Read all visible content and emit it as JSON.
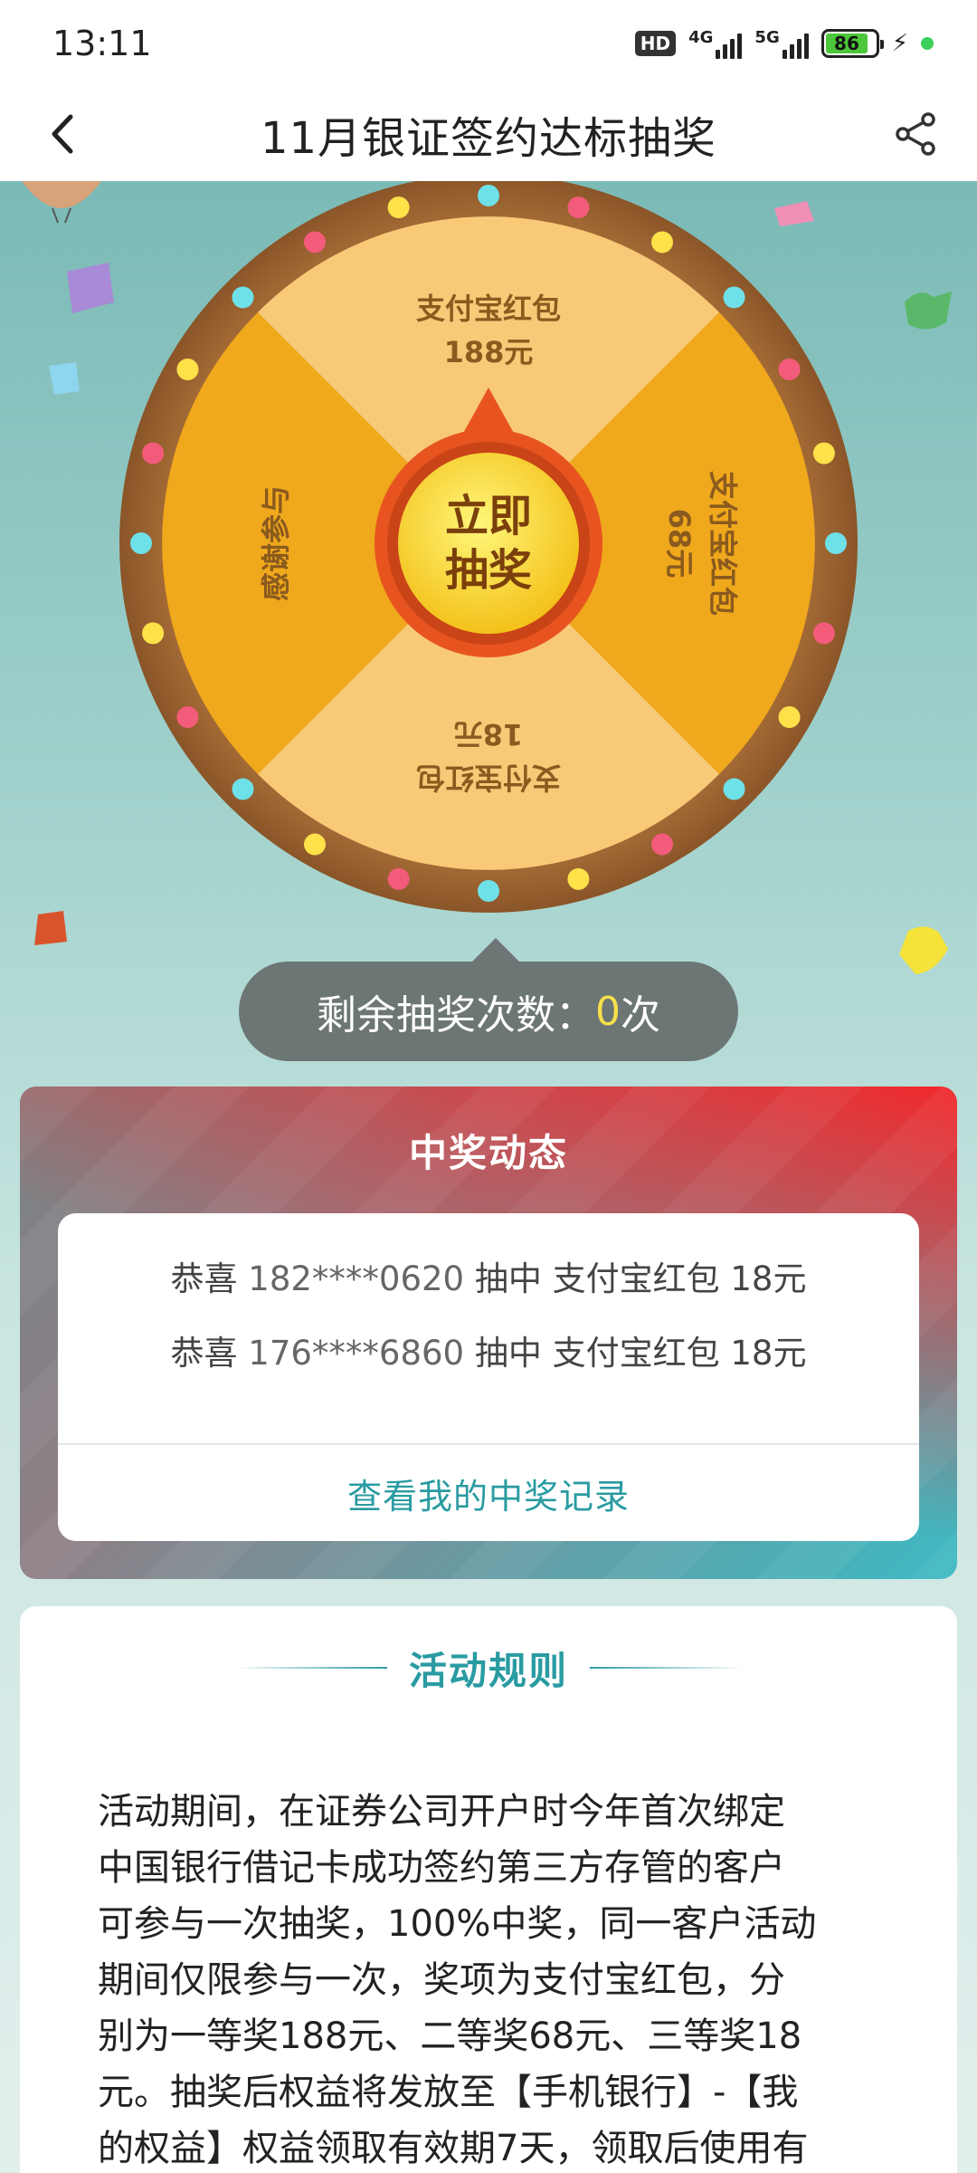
{
  "status_bar": {
    "time": "13:11",
    "hd_label": "HD",
    "net1": "4G",
    "net2": "5G",
    "battery": "86"
  },
  "nav": {
    "title": "11月银证签约达标抽奖",
    "back_icon": "chevron-left-icon",
    "share_icon": "share-icon"
  },
  "wheel": {
    "segments": [
      {
        "label_line1": "支付宝红包",
        "label_line2": "188元"
      },
      {
        "label_line1": "支付宝红包",
        "label_line2": "68元"
      },
      {
        "label_line1": "支付宝红包",
        "label_line2": "18元"
      },
      {
        "label_line1": "感谢参与",
        "label_line2": ""
      }
    ],
    "center_button_line1": "立即",
    "center_button_line2": "抽奖"
  },
  "remain": {
    "prefix": "剩余抽奖次数：",
    "count": "0",
    "suffix": "次"
  },
  "winners": {
    "title": "中奖动态",
    "rows": [
      {
        "prefix": "恭喜",
        "phone": "182****0620",
        "action": "抽中",
        "prize": "支付宝红包 18元"
      },
      {
        "prefix": "恭喜",
        "phone": "176****6860",
        "action": "抽中",
        "prize": "支付宝红包 18元"
      }
    ],
    "records_link": "查看我的中奖记录"
  },
  "rules": {
    "title": "活动规则",
    "lines": [
      "活动期间，在证券公司开户时今年首次绑定",
      "中国银行借记卡成功签约第三方存管的客户",
      "可参与一次抽奖，100%中奖，同一客户活动",
      "期间仅限参与一次，奖项为支付宝红包，分",
      "别为一等奖188元、二等奖68元、三等奖18",
      "元。抽奖后权益将发放至【手机银行】-【我",
      "的权益】权益领取有效期7天，领取后使用有"
    ]
  }
}
